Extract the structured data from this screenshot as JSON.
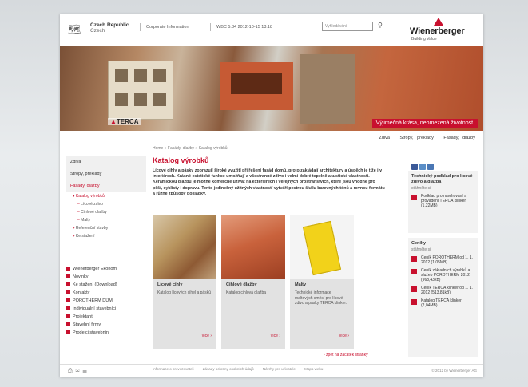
{
  "header": {
    "country": "Czech Republic",
    "country_sub": "Czech",
    "corporate": "Corporate Information",
    "web_version": "WBC 5.84 2012-10-15 13:18",
    "search_placeholder": "Vyhledávání",
    "logo_name": "Wienerberger",
    "logo_tag": "Building Value"
  },
  "hero": {
    "brand": "TERCA",
    "claim": "Výjimečná krása, neomezená životnost."
  },
  "topnav": [
    "Zdiva",
    "Stropy, překlady",
    "Fasády, dlažby"
  ],
  "breadcrumb": "Home » Fasády, dlažby » Katalog výrobků",
  "sidebar": {
    "items": [
      "Zdiva",
      "Stropy, překlady",
      "Fasády, dlažby"
    ],
    "sub": [
      "Katalog výrobků",
      "Lícové zdivo",
      "Cihlové dlažby",
      "Malty",
      "Referenční stavby",
      "Ke stažení"
    ]
  },
  "links": [
    "Wienerberger Ekonom",
    "Novinky",
    "Ke stažení (Download)",
    "Kontakty",
    "POROTHERM DŮM",
    "Individuální stavebníci",
    "Projektanti",
    "Stavební firmy",
    "Prodejci stavebnin"
  ],
  "main": {
    "title": "Katalog výrobků",
    "intro": "Lícové cihly a pásky zobrazují široké využití při řešení fasád domů, proto zakládají architektury a úspěch je tíže i v interiérech. Krásné estetické funkce umožňují a všestranné zdivo i velmi dobré tepelně akustické vlastnosti. Keramickou dlažbu je možné komerčně užívat na exteriérech i veřejných prostranstvích, které jsou vhodné pro pěší, cyklisty i dopravu. Tento jedinečný užitných vlastností vytváří pestrou škálu barevných tónů a rovnou formátu a různé způsoby pokládky."
  },
  "cards": [
    {
      "title": "Lícové cihly",
      "desc": "Katalog lícových cihel a pásků",
      "more": "více ›"
    },
    {
      "title": "Cihlové dlažby",
      "desc": "Katalog cihlová dlažba",
      "more": "více ›"
    },
    {
      "title": "Malty",
      "desc": "Technické informace maltových směsí pro lícové zdivo a pásky TERCA klinker.",
      "more": "více ›"
    }
  ],
  "backlink": "› zpět na začátek stránky",
  "right": {
    "box1_title": "Technický podklad pro lícové zdivo a dlažba",
    "box1_sub": "stáhněte si",
    "box1_items": [
      "Podklad pro navrhování a provádění TERCA klinker (1,22MB)"
    ],
    "box2_title": "Ceníky",
    "box2_sub": "stáhněte si",
    "box2_items": [
      "Ceník POROTHERM od 1. 1. 2012 (1,05MB)",
      "Ceník základních výrobků a služeb POROTHERM 2012 (968,43kB)",
      "Ceník TERCA klinker od 1. 1. 2012 (513,81kB)",
      "Katalog TERCA klinker (2,04MB)"
    ]
  },
  "footer": {
    "links": [
      "Informace o provozovateli",
      "Zásady ochrany osobních údajů",
      "Návrhy pro uživatele",
      "Mapa webu"
    ],
    "copy": "© 2012 by Wienerberger AG"
  },
  "colors": {
    "accent": "#c8102e"
  }
}
